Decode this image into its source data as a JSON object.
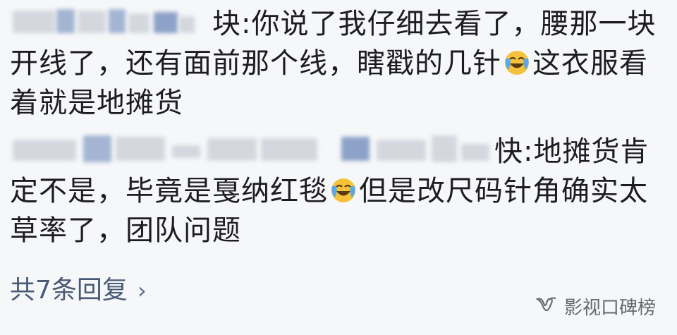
{
  "replies": [
    {
      "user_suffix": "块:",
      "text_first_line": "你说了我仔细去看了，腰那一块开线了，还有面前那个线，瞎戳的几针",
      "text_after_emoji": "这衣服看着就是地摊货"
    },
    {
      "user_suffix": "快:",
      "text_before_emoji": "地摊货肯定不是，毕竟是戛纳红毯",
      "text_after_emoji": "但是改尺码针角确实太草率了，团队问题"
    }
  ],
  "thread": {
    "more_replies_label": "共7条回复",
    "chevron": "›"
  },
  "watermark": {
    "logo_icon": "wechat-channel-logo",
    "text": "影视口碑榜"
  },
  "emoji": {
    "name": "laugh-cry-emoji",
    "face_color": "#f5c33b",
    "tear_color": "#5aa8e6"
  }
}
